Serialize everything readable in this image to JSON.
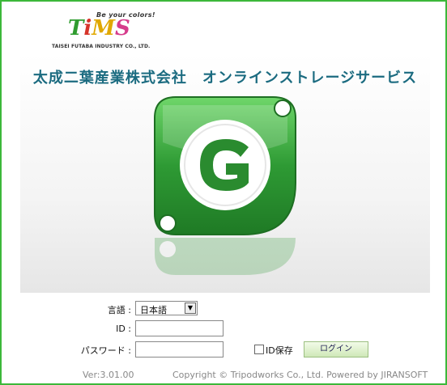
{
  "logo": {
    "tagline": "Be your colors!",
    "wordmark": [
      "T",
      "i",
      "M",
      "S"
    ],
    "wordmark_colors": [
      "#2f9c2f",
      "#d6342a",
      "#e0a800",
      "#d63c8c"
    ],
    "company_en": "TAISEI FUTABA INDUSTRY CO., LTD."
  },
  "banner": {
    "title": "太成二葉産業株式会社　オンラインストレージサービス",
    "icon_letter": "G",
    "accent": "#2e9a34"
  },
  "form": {
    "language_label": "言語 :",
    "language_value": "日本語",
    "id_label": "ID :",
    "password_label": "パスワード :",
    "save_id_label": "ID保存",
    "login_button": "ログイン"
  },
  "footer": {
    "version": "Ver:3.01.00",
    "copyright": "Copyright © Tripodworks Co., Ltd. Powered by JIRANSOFT"
  }
}
